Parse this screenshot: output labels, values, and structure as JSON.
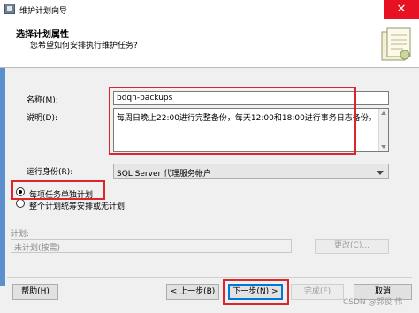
{
  "window": {
    "title": "维护计划向导",
    "close_glyph": "✕"
  },
  "header": {
    "title": "选择计划属性",
    "subtitle": "您希望如何安排执行维护任务?"
  },
  "form": {
    "name_label": "名称(M):",
    "name_value": "bdqn-backups",
    "desc_label": "说明(D):",
    "desc_value": "每周日晚上22:00进行完整备份，每天12:00和18:00进行事务日志备份。",
    "run_as_label": "运行身份(R):",
    "run_as_value": "SQL Server 代理服务帐户",
    "option_separate": "每项任务单独计划",
    "option_single": "整个计划统筹安排或无计划",
    "schedule_label": "计划:",
    "schedule_value": "未计划(按需)",
    "change_button": "更改(C)..."
  },
  "buttons": {
    "help": "帮助(H)",
    "back": "< 上一步(B)",
    "next": "下一步(N) >",
    "finish": "完成(F)",
    "cancel": "取消"
  },
  "watermark": "CSDN @郭俊 伟",
  "colors": {
    "highlight": "#e0242c",
    "accent": "#0078d7",
    "close": "#e81123"
  }
}
